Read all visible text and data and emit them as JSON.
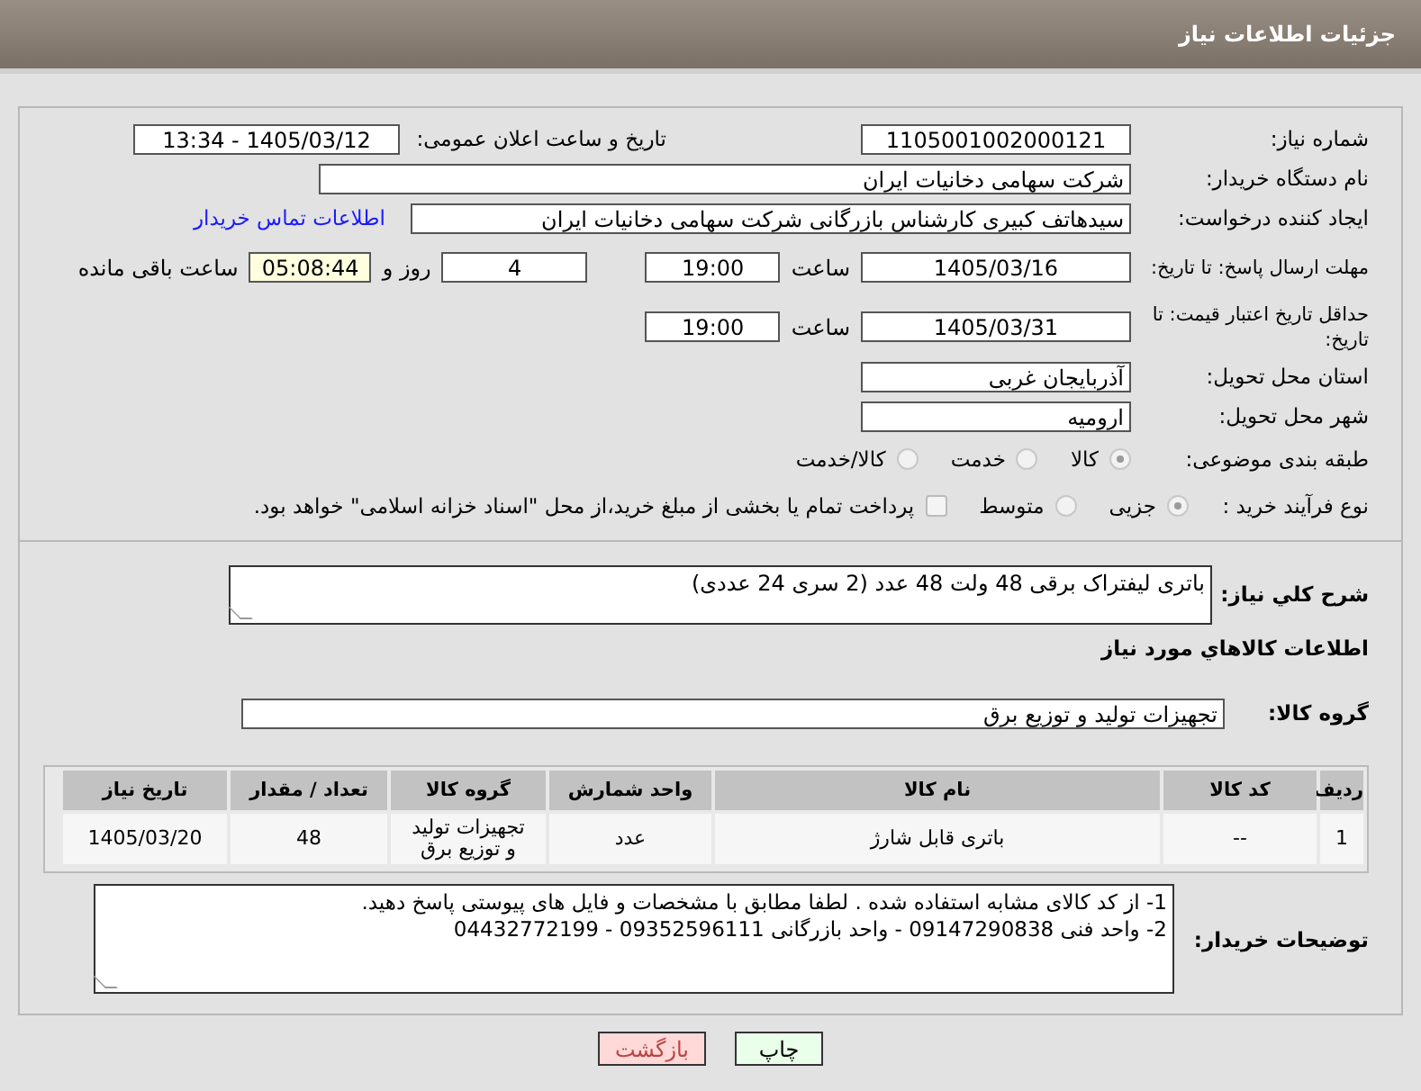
{
  "header": {
    "title": "جزئیات اطلاعات نیاز"
  },
  "need_number": {
    "label": "شماره نیاز:",
    "value": "1105001002000121"
  },
  "announce": {
    "label": "تاریخ و ساعت اعلان عمومی:",
    "value": "1405/03/12 - 13:34"
  },
  "buyer": {
    "label": "نام دستگاه خریدار:",
    "value": "شرکت سهامی دخانیات ایران"
  },
  "creator": {
    "label": "ایجاد کننده درخواست:",
    "value": "سیدهاتف کبیری کارشناس بازرگانی شرکت سهامی دخانیات ایران",
    "link": "اطلاعات تماس خریدار"
  },
  "deadline": {
    "label": "مهلت ارسال پاسخ: تا تاریخ:",
    "date": "1405/03/16",
    "time_label": "ساعت",
    "time": "19:00",
    "days": "4",
    "days_label": "روز و",
    "remaining": "05:08:44",
    "remaining_label": "ساعت باقی مانده"
  },
  "validity": {
    "label": "حداقل تاریخ اعتبار قیمت: تا تاریخ:",
    "date": "1405/03/31",
    "time_label": "ساعت",
    "time": "19:00"
  },
  "province": {
    "label": "استان محل تحویل:",
    "value": "آذربایجان غربی"
  },
  "city": {
    "label": "شهر محل تحویل:",
    "value": "ارومیه"
  },
  "category": {
    "label": "طبقه بندی موضوعی:",
    "options": [
      {
        "label": "کالا",
        "selected": true
      },
      {
        "label": "خدمت",
        "selected": false
      },
      {
        "label": "کالا/خدمت",
        "selected": false
      }
    ]
  },
  "process": {
    "label": "نوع فرآیند خرید :",
    "options": [
      {
        "label": "جزیی",
        "selected": true
      },
      {
        "label": "متوسط",
        "selected": false
      }
    ],
    "payment": {
      "label": "پرداخت تمام یا بخشی از مبلغ خرید،از محل \"اسناد خزانه اسلامی\" خواهد بود.",
      "checked": false
    }
  },
  "description": {
    "label": "شرح کلي نياز:",
    "value": "باتری لیفتراک برقی 48 ولت 48 عدد (2 سری 24 عددی)"
  },
  "goods_heading": "اطلاعات کالاهاي مورد نياز",
  "goods_group": {
    "label": "گروه کالا:",
    "value": "تجهیزات تولید و توزیع برق"
  },
  "table": {
    "columns": [
      "ردیف",
      "کد کالا",
      "نام کالا",
      "واحد شمارش",
      "گروه کالا",
      "تعداد / مقدار",
      "تاریخ نیاز"
    ],
    "rows": [
      [
        "1",
        "--",
        "باتری قابل شارژ",
        "عدد",
        "تجهیزات تولید و توزیع برق",
        "48",
        "1405/03/20"
      ]
    ]
  },
  "buyer_notes": {
    "label": "توضیحات خریدار:",
    "lines": [
      "1- از کد کالای مشابه استفاده شده . لطفا مطابق با مشخصات و فایل های پیوستی پاسخ دهید.",
      "2- واحد فنی     09147290838   - واحد بازرگانی  09352596111 - 04432772199"
    ]
  },
  "buttons": [
    {
      "label": "چاپ",
      "kind": "print"
    },
    {
      "label": "بازگشت",
      "kind": "back"
    }
  ]
}
